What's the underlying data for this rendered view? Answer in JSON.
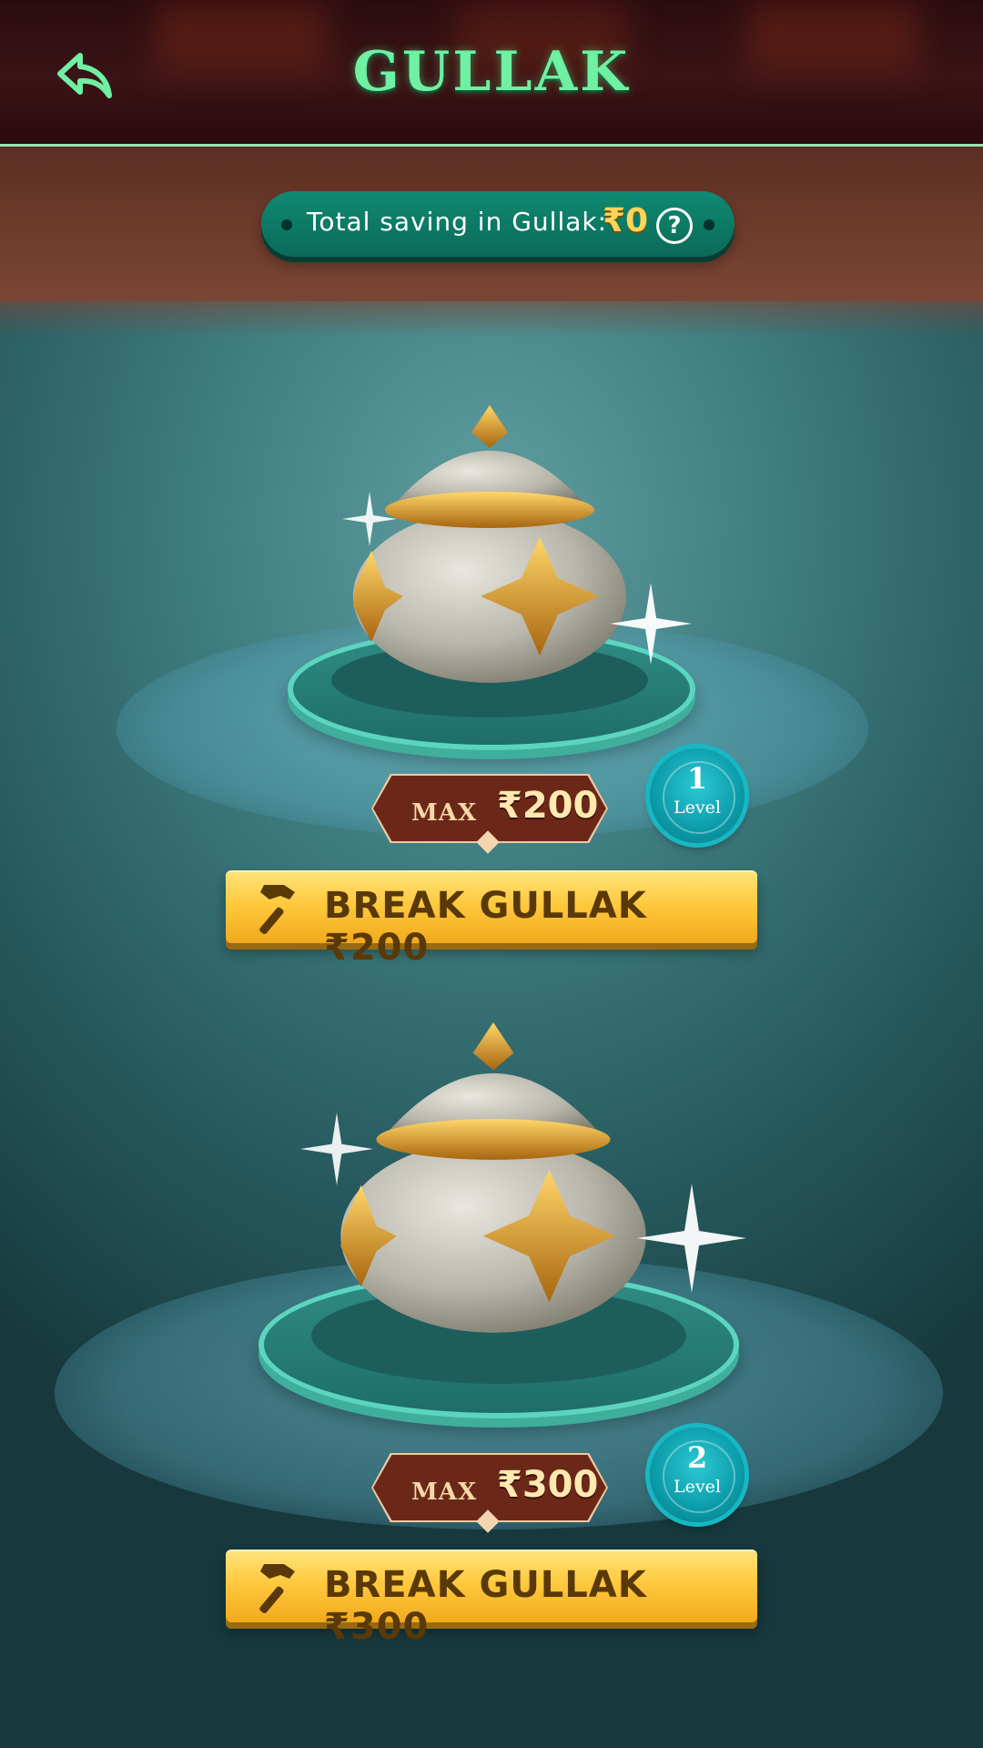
{
  "header": {
    "title": "GULLAK",
    "back_icon": "back-arrow-icon"
  },
  "savings": {
    "label": "Total saving in Gullak:",
    "value": "₹0",
    "help_icon": "question-icon"
  },
  "gullaks": [
    {
      "max_label": "MAX",
      "max_value": "₹200",
      "level_number": "1",
      "level_text": "Level",
      "button_label": "BREAK GULLAK ₹200"
    },
    {
      "max_label": "MAX",
      "max_value": "₹300",
      "level_number": "2",
      "level_text": "Level",
      "button_label": "BREAK GULLAK ₹300"
    }
  ],
  "colors": {
    "title": "#6ff0a3",
    "pill": "#0f8a72",
    "button": "#ffc93e",
    "badge": "#0b9aa8"
  }
}
